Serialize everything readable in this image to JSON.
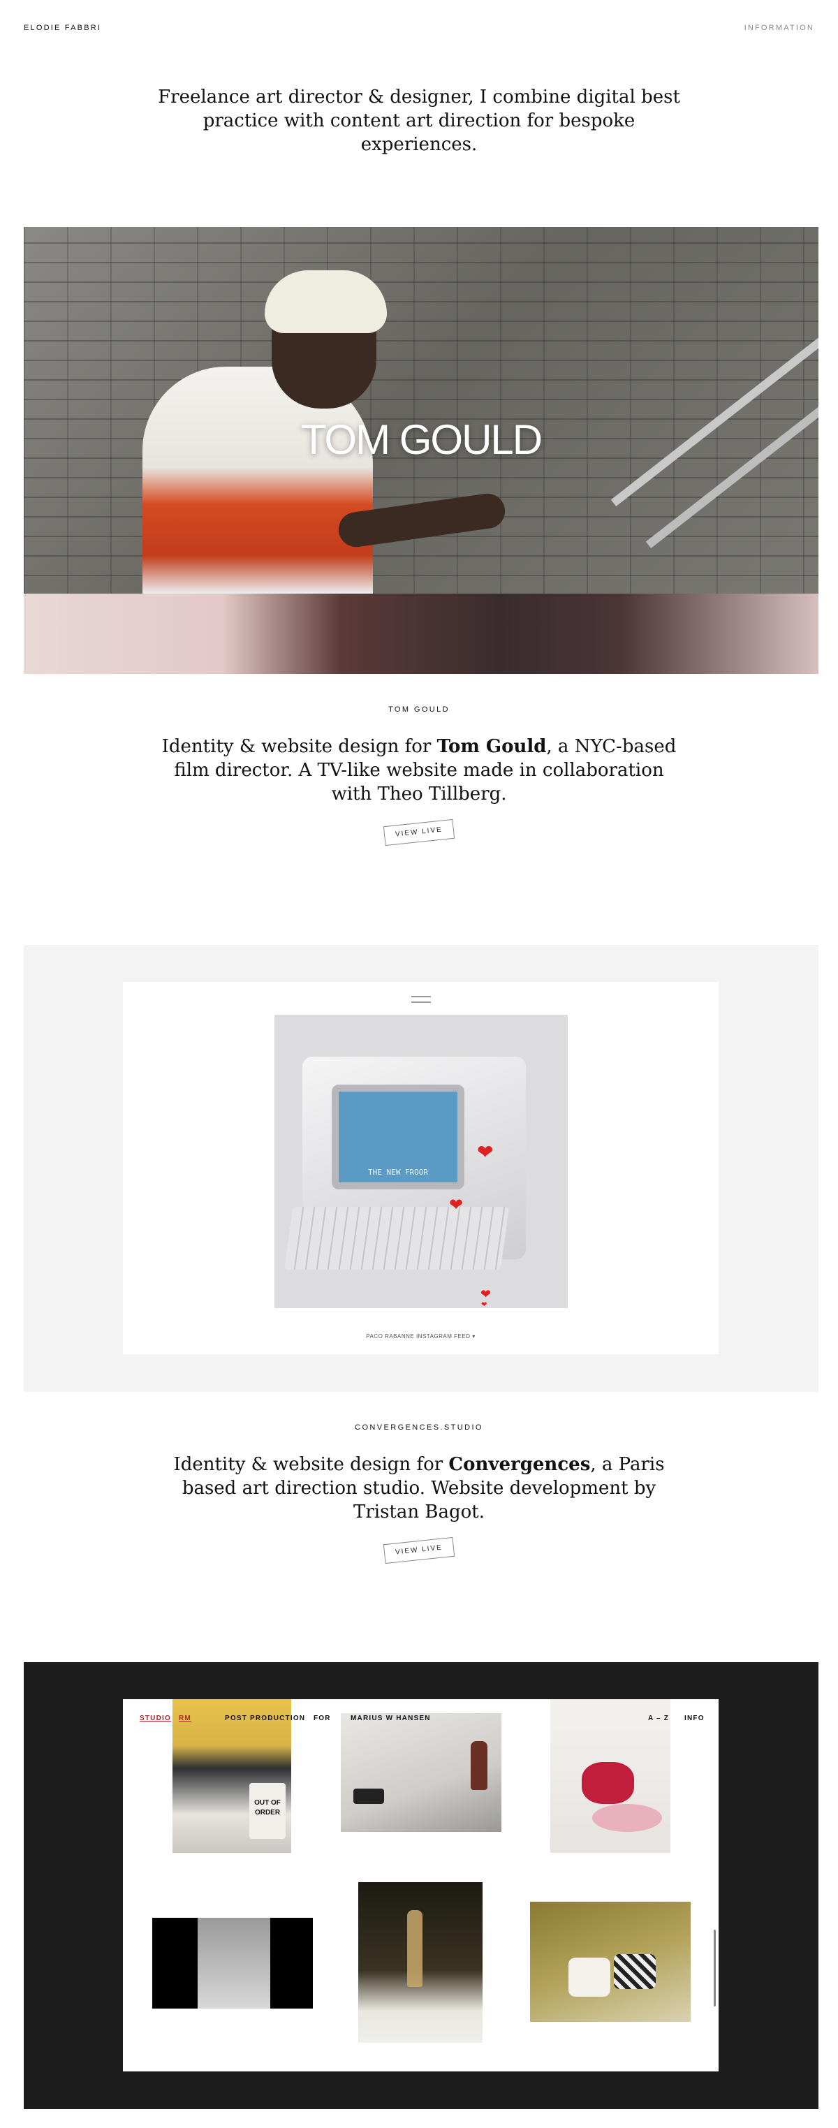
{
  "header": {
    "brand": "ELODIE FABBRI",
    "info_link": "INFORMATION"
  },
  "intro": "Freelance art director & designer, I combine digital best practice with content art direction for bespoke experiences.",
  "projects": [
    {
      "hero_title": "TOM GOULD",
      "label": "TOM GOULD",
      "desc_before": "Identity & website design for ",
      "desc_bold": "Tom Gould",
      "desc_after": ", a NYC-based film director. A TV-like website made in collaboration with Theo Tillberg.",
      "cta": "VIEW LIVE"
    },
    {
      "screen_text": "THE NEW FROOR",
      "feed_caption": "PACO RABANNE INSTAGRAM FEED",
      "label": "CONVERGENCES.STUDIO",
      "desc_before": "Identity & website design for ",
      "desc_bold": "Convergences",
      "desc_after": ", a Paris based art direction studio. Website development by Tristan Bagot.",
      "cta": "VIEW LIVE"
    },
    {
      "nav": {
        "studio": "STUDIO",
        "code": "RM",
        "post": "POST PRODUCTION",
        "for": "FOR",
        "client": "MARIUS W HANSEN",
        "az": "A – Z",
        "info": "INFO"
      },
      "sign_text": "OUT OF ORDER"
    }
  ],
  "colors": {
    "text": "#111111",
    "muted": "#888888",
    "panel_light": "#f3f3f3",
    "panel_dark": "#1e1d1d",
    "accent_red": "#b0262a"
  }
}
